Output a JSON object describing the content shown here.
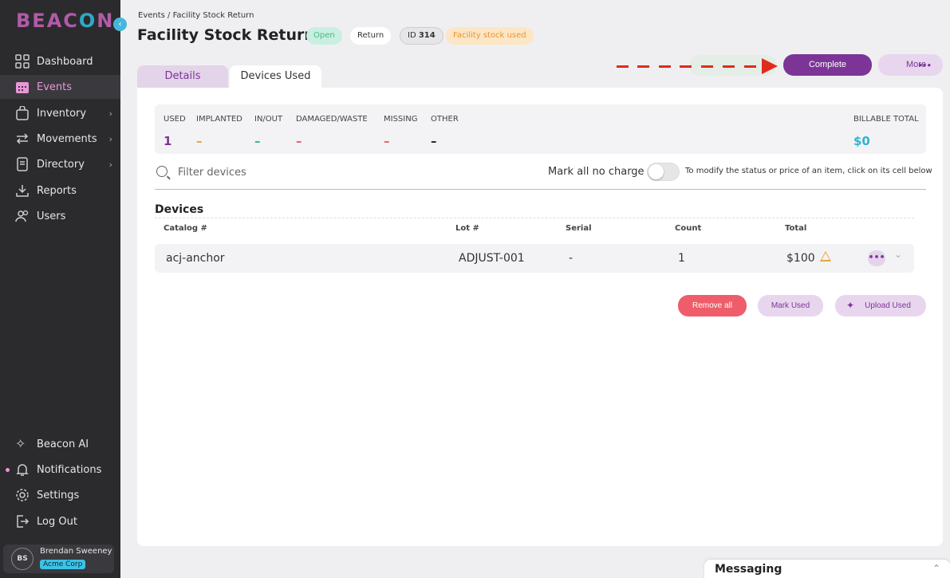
{
  "sidebar": {
    "logo": "BEACON",
    "collapse_icon": "‹",
    "items": [
      {
        "label": "Dashboard",
        "icon": "grid-icon"
      },
      {
        "label": "Events",
        "icon": "calendar-icon",
        "active": true
      },
      {
        "label": "Inventory",
        "icon": "bag-icon",
        "chevron": "›"
      },
      {
        "label": "Movements",
        "icon": "swap-icon",
        "chevron": "›"
      },
      {
        "label": "Directory",
        "icon": "book-icon",
        "chevron": "›"
      },
      {
        "label": "Reports",
        "icon": "download-icon"
      },
      {
        "label": "Users",
        "icon": "users-icon"
      }
    ],
    "bottom_items": [
      {
        "label": "Beacon AI",
        "icon": "sparkle-icon"
      },
      {
        "label": "Notifications",
        "icon": "bell-icon"
      },
      {
        "label": "Settings",
        "icon": "gear-icon"
      },
      {
        "label": "Log Out",
        "icon": "logout-icon"
      }
    ],
    "user": {
      "initials": "BS",
      "name": "Brendan Sweeney",
      "org": "Acme Corp"
    }
  },
  "header": {
    "breadcrumb": "Events / Facility Stock Return",
    "title": "Facility Stock Return",
    "badges": {
      "status": "Open",
      "type": "Return",
      "id_label": "ID",
      "id_value": "314",
      "tag": "Facility stock used"
    },
    "actions": {
      "complete": "Complete",
      "more": "More",
      "more_dots": "•••"
    }
  },
  "tabs": [
    {
      "label": "Details"
    },
    {
      "label": "Devices Used",
      "active": true
    }
  ],
  "stats": [
    {
      "label": "USED",
      "value": "1",
      "color": "#7c3597"
    },
    {
      "label": "IMPLANTED",
      "value": "–",
      "color": "#e8a33c"
    },
    {
      "label": "IN/OUT",
      "value": "–",
      "color": "#3bb38a"
    },
    {
      "label": "DAMAGED/WASTE",
      "value": "–",
      "color": "#ef5d6a"
    },
    {
      "label": "MISSING",
      "value": "–",
      "color": "#ef5d6a"
    },
    {
      "label": "OTHER",
      "value": "–",
      "color": "#222222"
    },
    {
      "label": "BILLABLE TOTAL",
      "value": "$0",
      "color": "#2fb3d0"
    }
  ],
  "filter": {
    "placeholder": "Filter devices",
    "no_charge_label": "Mark all no charge",
    "hint": "To modify the status or price of an item, click on its cell below"
  },
  "devices": {
    "title": "Devices",
    "columns": [
      "Catalog #",
      "Lot #",
      "Serial",
      "Count",
      "Total"
    ],
    "rows": [
      {
        "catalog": "acj-anchor",
        "lot": "ADJUST-001",
        "serial": "-",
        "count": "1",
        "total": "$100",
        "row_more": "•••",
        "expand": "⌄"
      }
    ]
  },
  "bulk_actions": {
    "remove_all": "Remove all",
    "mark_used": "Mark Used",
    "upload_used": "Upload Used"
  },
  "messaging": {
    "title": "Messaging",
    "chevron": "⌃"
  }
}
